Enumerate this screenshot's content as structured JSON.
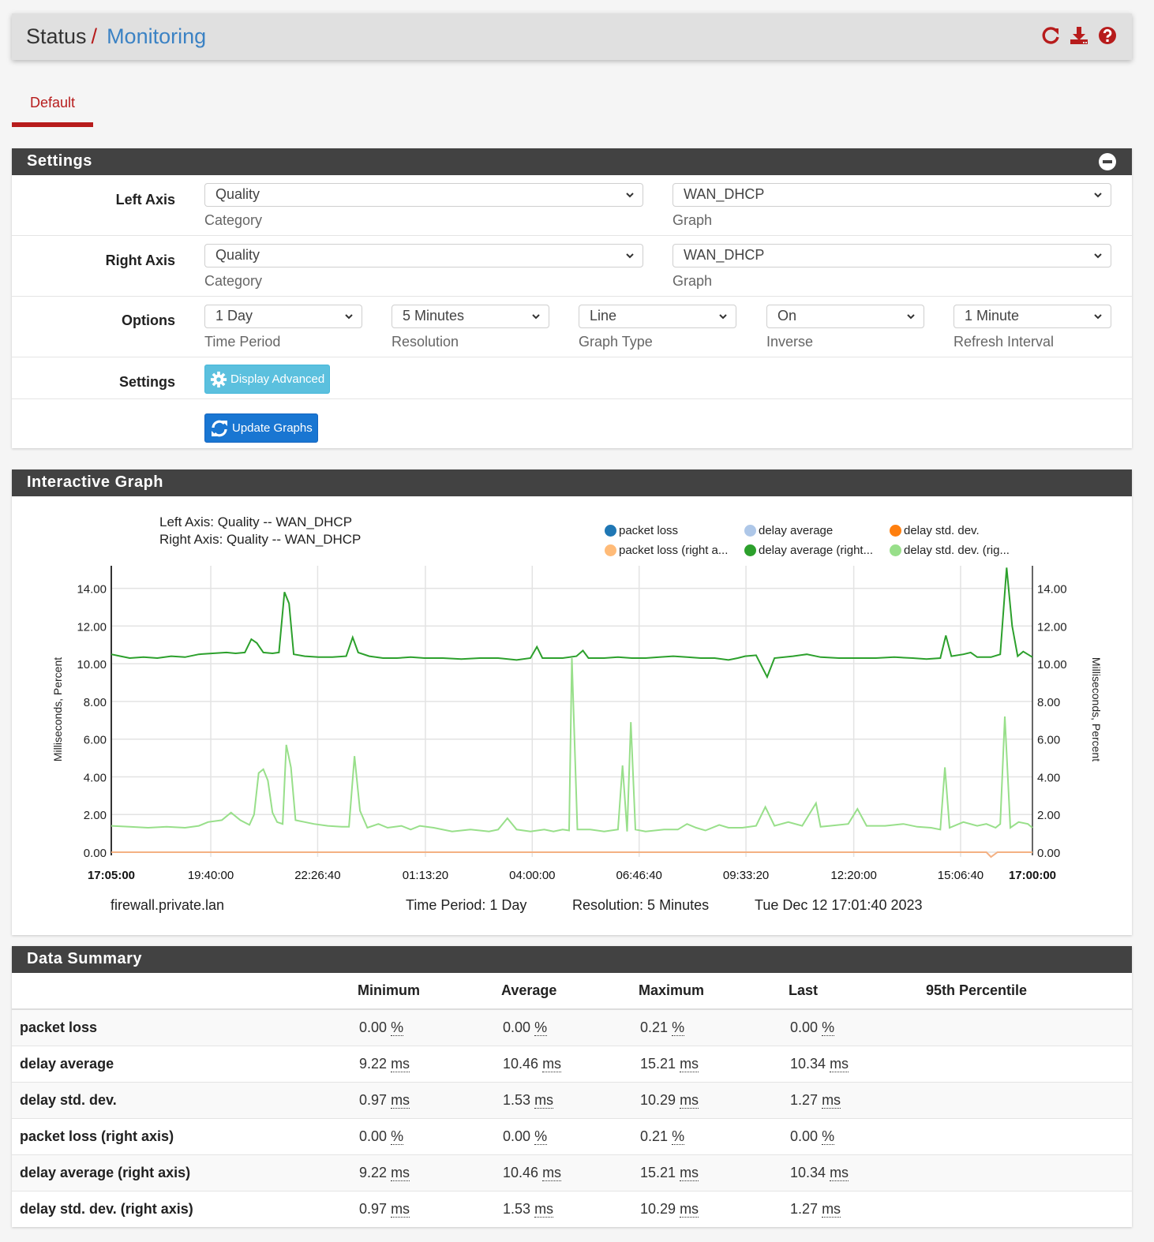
{
  "header": {
    "breadcrumb_root": "Status",
    "breadcrumb_sep": "/",
    "breadcrumb_current": "Monitoring",
    "icons": [
      "reload-icon",
      "download-icon",
      "help-icon"
    ]
  },
  "tabs": [
    {
      "label": "Default",
      "active": true
    }
  ],
  "settings": {
    "title": "Settings",
    "left_axis": {
      "label": "Left Axis",
      "category_value": "Quality",
      "category_help": "Category",
      "graph_value": "WAN_DHCP",
      "graph_help": "Graph"
    },
    "right_axis": {
      "label": "Right Axis",
      "category_value": "Quality",
      "category_help": "Category",
      "graph_value": "WAN_DHCP",
      "graph_help": "Graph"
    },
    "options": {
      "label": "Options",
      "fields": [
        {
          "value": "1 Day",
          "help": "Time Period"
        },
        {
          "value": "5 Minutes",
          "help": "Resolution"
        },
        {
          "value": "Line",
          "help": "Graph Type"
        },
        {
          "value": "On",
          "help": "Inverse"
        },
        {
          "value": "1 Minute",
          "help": "Refresh Interval"
        }
      ]
    },
    "settings_row": {
      "label": "Settings",
      "display_advanced": "Display Advanced"
    },
    "update_graphs": "Update Graphs"
  },
  "graph": {
    "title": "Interactive Graph",
    "footer": {
      "host": "firewall.private.lan",
      "time_period": "Time Period: 1 Day",
      "resolution": "Resolution: 5 Minutes",
      "timestamp": "Tue Dec 12 17:01:40 2023"
    }
  },
  "chart_data": {
    "type": "line",
    "title_lines": [
      "Left Axis: Quality -- WAN_DHCP",
      "Right Axis: Quality -- WAN_DHCP"
    ],
    "ylabel_left": "Milliseconds, Percent",
    "ylabel_right": "Milliseconds, Percent",
    "ylim": [
      0,
      15.2
    ],
    "yticks": [
      "0.00",
      "2.00",
      "4.00",
      "6.00",
      "8.00",
      "10.00",
      "12.00",
      "14.00"
    ],
    "ytick_values": [
      0,
      2,
      4,
      6,
      8,
      10,
      12,
      14
    ],
    "xticks": [
      "17:05:00",
      "19:40:00",
      "22:26:40",
      "01:13:20",
      "04:00:00",
      "06:46:40",
      "09:33:20",
      "12:20:00",
      "15:06:40",
      "17:00:00"
    ],
    "xtick_bold": [
      true,
      false,
      false,
      false,
      false,
      false,
      false,
      false,
      false,
      true
    ],
    "xtick_positions": [
      0,
      0.108,
      0.224,
      0.341,
      0.457,
      0.573,
      0.689,
      0.806,
      0.922,
      1.0
    ],
    "grid": true,
    "legend": {
      "placement": "top-right",
      "entries": [
        {
          "label": "packet loss",
          "color": "#1f77b4"
        },
        {
          "label": "delay average",
          "color": "#aec7e8"
        },
        {
          "label": "delay std. dev.",
          "color": "#ff7f0e"
        },
        {
          "label": "packet loss (right a...",
          "color": "#ffbb78"
        },
        {
          "label": "delay average (right...",
          "color": "#2ca02c"
        },
        {
          "label": "delay std. dev. (rig...",
          "color": "#98df8a"
        }
      ]
    },
    "series": [
      {
        "name": "delay average (right axis)",
        "color": "#2ca02c",
        "points": [
          [
            0,
            10.5
          ],
          [
            0.01,
            10.4
          ],
          [
            0.02,
            10.3
          ],
          [
            0.035,
            10.35
          ],
          [
            0.05,
            10.3
          ],
          [
            0.065,
            10.4
          ],
          [
            0.08,
            10.35
          ],
          [
            0.095,
            10.5
          ],
          [
            0.11,
            10.55
          ],
          [
            0.125,
            10.6
          ],
          [
            0.135,
            10.55
          ],
          [
            0.145,
            10.6
          ],
          [
            0.152,
            11.3
          ],
          [
            0.158,
            11.1
          ],
          [
            0.165,
            10.6
          ],
          [
            0.175,
            10.55
          ],
          [
            0.182,
            10.6
          ],
          [
            0.188,
            13.8
          ],
          [
            0.193,
            13.2
          ],
          [
            0.198,
            10.5
          ],
          [
            0.21,
            10.4
          ],
          [
            0.225,
            10.35
          ],
          [
            0.24,
            10.35
          ],
          [
            0.255,
            10.4
          ],
          [
            0.262,
            11.4
          ],
          [
            0.268,
            10.6
          ],
          [
            0.28,
            10.4
          ],
          [
            0.295,
            10.3
          ],
          [
            0.31,
            10.3
          ],
          [
            0.325,
            10.35
          ],
          [
            0.34,
            10.3
          ],
          [
            0.36,
            10.3
          ],
          [
            0.38,
            10.25
          ],
          [
            0.4,
            10.3
          ],
          [
            0.42,
            10.3
          ],
          [
            0.44,
            10.2
          ],
          [
            0.455,
            10.3
          ],
          [
            0.462,
            10.9
          ],
          [
            0.468,
            10.3
          ],
          [
            0.49,
            10.3
          ],
          [
            0.505,
            10.4
          ],
          [
            0.512,
            10.7
          ],
          [
            0.518,
            10.3
          ],
          [
            0.535,
            10.3
          ],
          [
            0.55,
            10.35
          ],
          [
            0.565,
            10.3
          ],
          [
            0.58,
            10.3
          ],
          [
            0.595,
            10.35
          ],
          [
            0.61,
            10.4
          ],
          [
            0.625,
            10.35
          ],
          [
            0.64,
            10.3
          ],
          [
            0.655,
            10.3
          ],
          [
            0.67,
            10.2
          ],
          [
            0.68,
            10.3
          ],
          [
            0.688,
            10.4
          ],
          [
            0.7,
            10.45
          ],
          [
            0.712,
            9.3
          ],
          [
            0.72,
            10.3
          ],
          [
            0.74,
            10.4
          ],
          [
            0.755,
            10.5
          ],
          [
            0.77,
            10.35
          ],
          [
            0.79,
            10.3
          ],
          [
            0.81,
            10.3
          ],
          [
            0.83,
            10.3
          ],
          [
            0.85,
            10.35
          ],
          [
            0.87,
            10.3
          ],
          [
            0.885,
            10.25
          ],
          [
            0.9,
            10.3
          ],
          [
            0.906,
            11.5
          ],
          [
            0.912,
            10.4
          ],
          [
            0.925,
            10.5
          ],
          [
            0.933,
            10.6
          ],
          [
            0.94,
            10.35
          ],
          [
            0.955,
            10.35
          ],
          [
            0.965,
            10.5
          ],
          [
            0.972,
            15.1
          ],
          [
            0.978,
            12.0
          ],
          [
            0.984,
            10.4
          ],
          [
            0.99,
            10.65
          ],
          [
            1.0,
            10.35
          ]
        ]
      },
      {
        "name": "delay std. dev. (right axis)",
        "color": "#98df8a",
        "points": [
          [
            0,
            1.4
          ],
          [
            0.02,
            1.35
          ],
          [
            0.04,
            1.3
          ],
          [
            0.06,
            1.35
          ],
          [
            0.08,
            1.3
          ],
          [
            0.095,
            1.4
          ],
          [
            0.105,
            1.6
          ],
          [
            0.12,
            1.7
          ],
          [
            0.13,
            2.1
          ],
          [
            0.14,
            1.7
          ],
          [
            0.15,
            1.45
          ],
          [
            0.155,
            2.0
          ],
          [
            0.16,
            4.2
          ],
          [
            0.165,
            4.4
          ],
          [
            0.17,
            3.8
          ],
          [
            0.175,
            2.1
          ],
          [
            0.18,
            1.6
          ],
          [
            0.186,
            1.5
          ],
          [
            0.19,
            5.7
          ],
          [
            0.195,
            4.5
          ],
          [
            0.2,
            1.7
          ],
          [
            0.21,
            1.6
          ],
          [
            0.22,
            1.5
          ],
          [
            0.235,
            1.4
          ],
          [
            0.25,
            1.35
          ],
          [
            0.258,
            1.35
          ],
          [
            0.264,
            5.1
          ],
          [
            0.27,
            2.2
          ],
          [
            0.278,
            1.3
          ],
          [
            0.29,
            1.5
          ],
          [
            0.3,
            1.3
          ],
          [
            0.315,
            1.4
          ],
          [
            0.325,
            1.2
          ],
          [
            0.335,
            1.4
          ],
          [
            0.35,
            1.3
          ],
          [
            0.37,
            1.1
          ],
          [
            0.39,
            1.2
          ],
          [
            0.41,
            1.1
          ],
          [
            0.42,
            1.2
          ],
          [
            0.43,
            1.8
          ],
          [
            0.44,
            1.2
          ],
          [
            0.455,
            1.1
          ],
          [
            0.47,
            1.2
          ],
          [
            0.48,
            1.1
          ],
          [
            0.49,
            1.2
          ],
          [
            0.497,
            1.15
          ],
          [
            0.5,
            10.3
          ],
          [
            0.506,
            1.2
          ],
          [
            0.52,
            1.2
          ],
          [
            0.535,
            1.1
          ],
          [
            0.55,
            1.2
          ],
          [
            0.555,
            4.6
          ],
          [
            0.56,
            1.1
          ],
          [
            0.564,
            6.9
          ],
          [
            0.569,
            1.2
          ],
          [
            0.58,
            1.1
          ],
          [
            0.6,
            1.2
          ],
          [
            0.615,
            1.2
          ],
          [
            0.625,
            1.5
          ],
          [
            0.635,
            1.3
          ],
          [
            0.645,
            1.15
          ],
          [
            0.66,
            1.45
          ],
          [
            0.67,
            1.3
          ],
          [
            0.685,
            1.3
          ],
          [
            0.7,
            1.4
          ],
          [
            0.71,
            2.4
          ],
          [
            0.72,
            1.4
          ],
          [
            0.735,
            1.6
          ],
          [
            0.75,
            1.4
          ],
          [
            0.77,
            1.35
          ],
          [
            0.765,
            2.6
          ],
          [
            0.78,
            1.4
          ],
          [
            0.8,
            1.5
          ],
          [
            0.81,
            2.3
          ],
          [
            0.82,
            1.4
          ],
          [
            0.84,
            1.4
          ],
          [
            0.86,
            1.5
          ],
          [
            0.875,
            1.35
          ],
          [
            0.89,
            1.3
          ],
          [
            0.9,
            1.2
          ],
          [
            0.905,
            4.5
          ],
          [
            0.91,
            1.3
          ],
          [
            0.925,
            1.6
          ],
          [
            0.94,
            1.4
          ],
          [
            0.95,
            1.5
          ],
          [
            0.96,
            1.3
          ],
          [
            0.965,
            1.5
          ],
          [
            0.97,
            7.2
          ],
          [
            0.976,
            1.3
          ],
          [
            0.985,
            1.6
          ],
          [
            0.995,
            1.5
          ],
          [
            1.0,
            1.3
          ]
        ]
      },
      {
        "name": "packet loss (right axis)",
        "color": "#f4b183",
        "points": [
          [
            0,
            0
          ],
          [
            0.95,
            0
          ],
          [
            0.955,
            -0.25
          ],
          [
            0.962,
            0
          ],
          [
            1.0,
            0
          ]
        ]
      }
    ]
  },
  "summary": {
    "title": "Data Summary",
    "columns": [
      "",
      "Minimum",
      "Average",
      "Maximum",
      "Last",
      "95th Percentile"
    ],
    "rows": [
      {
        "label": "packet loss",
        "values": [
          "0.00",
          "0.00",
          "0.21",
          "0.00",
          ""
        ],
        "unit": "%"
      },
      {
        "label": "delay average",
        "values": [
          "9.22",
          "10.46",
          "15.21",
          "10.34",
          ""
        ],
        "unit": "ms"
      },
      {
        "label": "delay std. dev.",
        "values": [
          "0.97",
          "1.53",
          "10.29",
          "1.27",
          ""
        ],
        "unit": "ms"
      },
      {
        "label": "packet loss (right axis)",
        "values": [
          "0.00",
          "0.00",
          "0.21",
          "0.00",
          ""
        ],
        "unit": "%"
      },
      {
        "label": "delay average (right axis)",
        "values": [
          "9.22",
          "10.46",
          "15.21",
          "10.34",
          ""
        ],
        "unit": "ms"
      },
      {
        "label": "delay std. dev. (right axis)",
        "values": [
          "0.97",
          "1.53",
          "10.29",
          "1.27",
          ""
        ],
        "unit": "ms"
      }
    ]
  },
  "colors": {
    "accent_red": "#b71c1c",
    "link_blue": "#3b82c4",
    "panel_head": "#424242",
    "info_btn": "#5bc0de",
    "primary_btn": "#1976d2"
  }
}
